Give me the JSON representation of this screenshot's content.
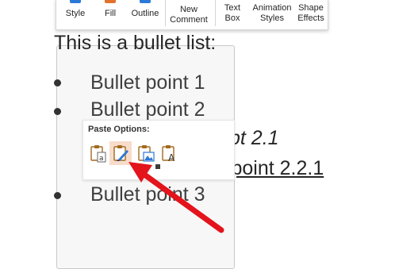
{
  "ribbon": {
    "buttons": [
      {
        "label": "Style",
        "color": "#2b79d6"
      },
      {
        "label": "Fill",
        "color": "#e2722b"
      },
      {
        "label": "Outline",
        "color": "#2b79d6"
      },
      {
        "label": "New\nComment",
        "color": "#2b79d6"
      },
      {
        "label": "Text\nBox",
        "color": "#2b79d6"
      },
      {
        "label": "Animation\nStyles",
        "color": "#2b79d6"
      },
      {
        "label": "Shape\nEffects",
        "color": "#2b79d6"
      }
    ]
  },
  "slide": {
    "title": "This is a bullet list:",
    "bullets": [
      "Bullet point 1",
      "Bullet point 2",
      "Bullet point 3"
    ],
    "sub_bullet": "pt 2.1",
    "subsub_bullet": "Bullet point 2.2.1"
  },
  "paste_options": {
    "title": "Paste Options:",
    "buttons": [
      "keep-source-formatting",
      "use-destination-theme",
      "picture",
      "keep-text-only"
    ],
    "active_index": 1
  },
  "colors": {
    "arrow": "#e3141b",
    "highlight": "#f7dccb"
  }
}
